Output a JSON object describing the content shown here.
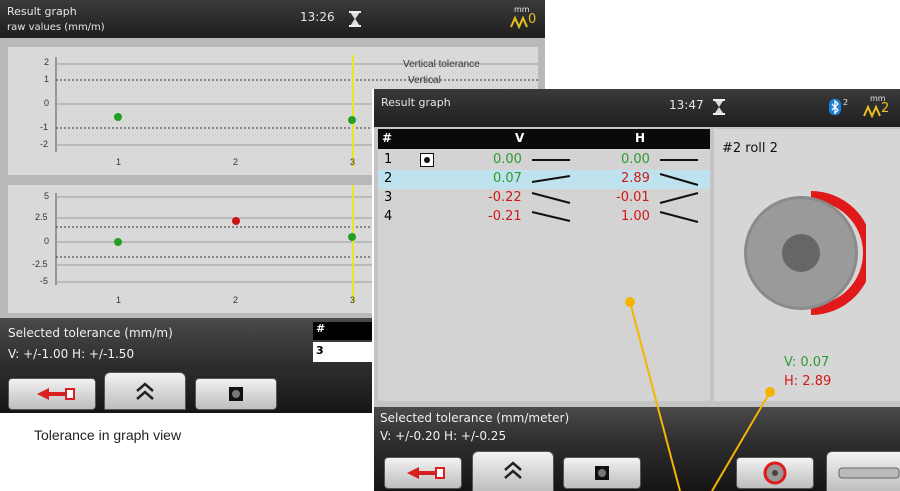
{
  "back_screen": {
    "title": "Result graph",
    "subtitle": "raw values (mm/m)",
    "time": "13:26",
    "unit": "mm",
    "unit_value": "0",
    "graph1": {
      "legend_tolerance": "Vertical tolerance",
      "legend_series": "Vertical",
      "y_ticks": [
        "2",
        "1",
        "0",
        "-1",
        "-2"
      ],
      "x_ticks": [
        "1",
        "2",
        "3"
      ]
    },
    "graph2": {
      "y_ticks": [
        "5",
        "2.5",
        "0",
        "-2.5",
        "-5"
      ],
      "x_ticks": [
        "1",
        "2",
        "3"
      ]
    },
    "footer_title": "Selected tolerance (mm/m)",
    "footer_values": "V: +/-1.00   H: +/-1.50",
    "side_table_header": "#",
    "side_table_value": "3",
    "colors": {
      "point_green": "#22a022",
      "point_red": "#cc1111",
      "cursor_yellow": "#e8e820"
    }
  },
  "front_screen": {
    "title": "Result graph",
    "time": "13:47",
    "bluetooth_count": "2",
    "unit": "mm",
    "unit_value": "2",
    "table": {
      "headers": {
        "num": "#",
        "v": "V",
        "h": "H"
      },
      "rows": [
        {
          "num": "1",
          "v": "0.00",
          "h": "0.00"
        },
        {
          "num": "2",
          "v": "0.07",
          "h": "2.89"
        },
        {
          "num": "3",
          "v": "-0.22",
          "h": "-0.01"
        },
        {
          "num": "4",
          "v": "-0.21",
          "h": "1.00"
        }
      ]
    },
    "side": {
      "title": "#2 roll 2",
      "v_readout": "V: 0.07",
      "h_readout": "H: 2.89"
    },
    "footer_title": "Selected tolerance (mm/meter)",
    "footer_values": "V: +/-0.20   H: +/-0.25",
    "colors": {
      "selected_row": "#bfe3ee",
      "accent_orange": "#f5b400",
      "roll_red": "#e01a1a"
    }
  },
  "caption": "Tolerance in graph view"
}
